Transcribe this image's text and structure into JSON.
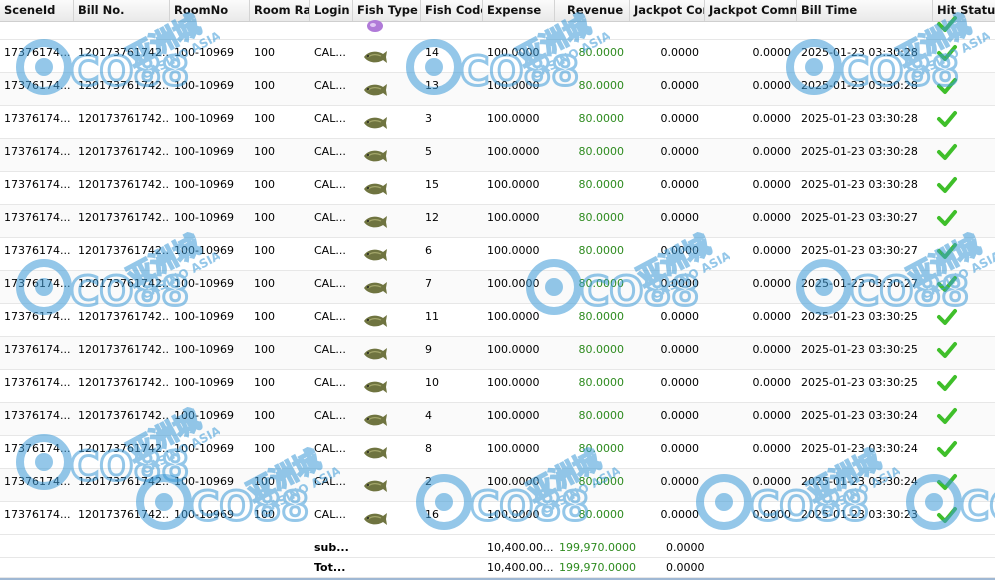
{
  "columns": {
    "scene_id": "SceneId",
    "bill_no": "Bill No.",
    "room_no": "RoomNo",
    "room_rate": "Room Rat",
    "login": "Login I",
    "fish_type": "Fish Type",
    "fish_code": "Fish Code",
    "expense": "Expense",
    "revenue": "Revenue",
    "jackpot_con": "Jackpot Con",
    "jackpot_comm": "Jackpot Comm",
    "bill_time": "Bill Time",
    "hit_status": "Hit Status"
  },
  "rows": [
    {
      "scene_id": "17376174...",
      "bill_no": "120173761742...",
      "room_no": "100-10969",
      "room_rate": "100",
      "login": "CAL...",
      "fish_code": "14",
      "expense": "100.0000",
      "revenue": "80.0000",
      "jackpot_con": "0.0000",
      "jackpot_comm": "0.0000",
      "bill_time": "2025-01-23 03:30:28"
    },
    {
      "scene_id": "17376174...",
      "bill_no": "120173761742...",
      "room_no": "100-10969",
      "room_rate": "100",
      "login": "CAL...",
      "fish_code": "13",
      "expense": "100.0000",
      "revenue": "80.0000",
      "jackpot_con": "0.0000",
      "jackpot_comm": "0.0000",
      "bill_time": "2025-01-23 03:30:28"
    },
    {
      "scene_id": "17376174...",
      "bill_no": "120173761742...",
      "room_no": "100-10969",
      "room_rate": "100",
      "login": "CAL...",
      "fish_code": "3",
      "expense": "100.0000",
      "revenue": "80.0000",
      "jackpot_con": "0.0000",
      "jackpot_comm": "0.0000",
      "bill_time": "2025-01-23 03:30:28"
    },
    {
      "scene_id": "17376174...",
      "bill_no": "120173761742...",
      "room_no": "100-10969",
      "room_rate": "100",
      "login": "CAL...",
      "fish_code": "5",
      "expense": "100.0000",
      "revenue": "80.0000",
      "jackpot_con": "0.0000",
      "jackpot_comm": "0.0000",
      "bill_time": "2025-01-23 03:30:28"
    },
    {
      "scene_id": "17376174...",
      "bill_no": "120173761742...",
      "room_no": "100-10969",
      "room_rate": "100",
      "login": "CAL...",
      "fish_code": "15",
      "expense": "100.0000",
      "revenue": "80.0000",
      "jackpot_con": "0.0000",
      "jackpot_comm": "0.0000",
      "bill_time": "2025-01-23 03:30:28"
    },
    {
      "scene_id": "17376174...",
      "bill_no": "120173761742...",
      "room_no": "100-10969",
      "room_rate": "100",
      "login": "CAL...",
      "fish_code": "12",
      "expense": "100.0000",
      "revenue": "80.0000",
      "jackpot_con": "0.0000",
      "jackpot_comm": "0.0000",
      "bill_time": "2025-01-23 03:30:27"
    },
    {
      "scene_id": "17376174...",
      "bill_no": "120173761742...",
      "room_no": "100-10969",
      "room_rate": "100",
      "login": "CAL...",
      "fish_code": "6",
      "expense": "100.0000",
      "revenue": "80.0000",
      "jackpot_con": "0.0000",
      "jackpot_comm": "0.0000",
      "bill_time": "2025-01-23 03:30:27"
    },
    {
      "scene_id": "17376174...",
      "bill_no": "120173761742...",
      "room_no": "100-10969",
      "room_rate": "100",
      "login": "CAL...",
      "fish_code": "7",
      "expense": "100.0000",
      "revenue": "80.0000",
      "jackpot_con": "0.0000",
      "jackpot_comm": "0.0000",
      "bill_time": "2025-01-23 03:30:27"
    },
    {
      "scene_id": "17376174...",
      "bill_no": "120173761742...",
      "room_no": "100-10969",
      "room_rate": "100",
      "login": "CAL...",
      "fish_code": "11",
      "expense": "100.0000",
      "revenue": "80.0000",
      "jackpot_con": "0.0000",
      "jackpot_comm": "0.0000",
      "bill_time": "2025-01-23 03:30:25"
    },
    {
      "scene_id": "17376174...",
      "bill_no": "120173761742...",
      "room_no": "100-10969",
      "room_rate": "100",
      "login": "CAL...",
      "fish_code": "9",
      "expense": "100.0000",
      "revenue": "80.0000",
      "jackpot_con": "0.0000",
      "jackpot_comm": "0.0000",
      "bill_time": "2025-01-23 03:30:25"
    },
    {
      "scene_id": "17376174...",
      "bill_no": "120173761742...",
      "room_no": "100-10969",
      "room_rate": "100",
      "login": "CAL...",
      "fish_code": "10",
      "expense": "100.0000",
      "revenue": "80.0000",
      "jackpot_con": "0.0000",
      "jackpot_comm": "0.0000",
      "bill_time": "2025-01-23 03:30:25"
    },
    {
      "scene_id": "17376174...",
      "bill_no": "120173761742...",
      "room_no": "100-10969",
      "room_rate": "100",
      "login": "CAL...",
      "fish_code": "4",
      "expense": "100.0000",
      "revenue": "80.0000",
      "jackpot_con": "0.0000",
      "jackpot_comm": "0.0000",
      "bill_time": "2025-01-23 03:30:24"
    },
    {
      "scene_id": "17376174...",
      "bill_no": "120173761742...",
      "room_no": "100-10969",
      "room_rate": "100",
      "login": "CAL...",
      "fish_code": "8",
      "expense": "100.0000",
      "revenue": "80.0000",
      "jackpot_con": "0.0000",
      "jackpot_comm": "0.0000",
      "bill_time": "2025-01-23 03:30:24"
    },
    {
      "scene_id": "17376174...",
      "bill_no": "120173761742...",
      "room_no": "100-10969",
      "room_rate": "100",
      "login": "CAL...",
      "fish_code": "2",
      "expense": "100.0000",
      "revenue": "80.0000",
      "jackpot_con": "0.0000",
      "jackpot_comm": "0.0000",
      "bill_time": "2025-01-23 03:30:24"
    },
    {
      "scene_id": "17376174...",
      "bill_no": "120173761742...",
      "room_no": "100-10969",
      "room_rate": "100",
      "login": "CAL...",
      "fish_code": "16",
      "expense": "100.0000",
      "revenue": "80.0000",
      "jackpot_con": "0.0000",
      "jackpot_comm": "0.0000",
      "bill_time": "2025-01-23 03:30:23"
    }
  ],
  "footer": {
    "subtotal": {
      "label": "sub...",
      "expense": "10,400.00...",
      "revenue": "199,970.0000",
      "jackpot_con": "0.0000"
    },
    "total": {
      "label": "Tot...",
      "expense": "10,400.00...",
      "revenue": "199,970.0000",
      "jackpot_con": "0.0000"
    }
  },
  "watermark": {
    "brand": "CO88",
    "cn": "亚洲城",
    "en": "CASINO ASIA"
  },
  "colors": {
    "revenue": "#2e8b1f",
    "check": "#3fbf2a",
    "watermark": "#3d9bd8"
  }
}
